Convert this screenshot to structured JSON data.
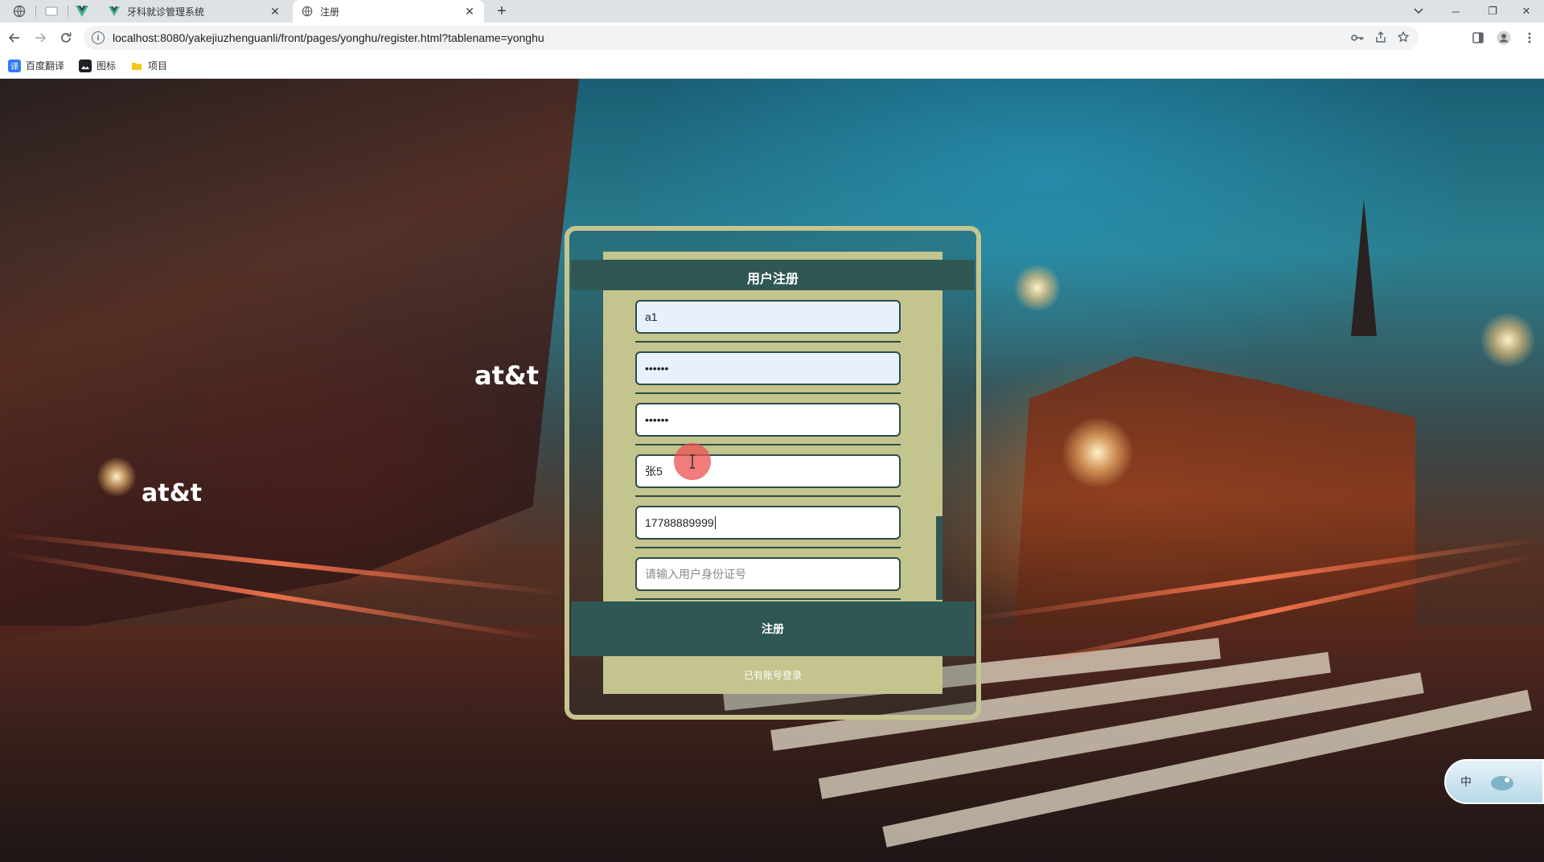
{
  "browser": {
    "tabs": [
      {
        "title": "牙科就诊管理系统",
        "active": false,
        "icon": "vue-logo-icon"
      },
      {
        "title": "注册",
        "active": true,
        "icon": "globe-icon"
      }
    ],
    "url": "localhost:8080/yakejiuzhenguanli/front/pages/yonghu/register.html?tablename=yonghu",
    "bookmarks": [
      {
        "label": "百度翻译",
        "icon": "baidu-translate-icon"
      },
      {
        "label": "图标",
        "icon": "image-icon"
      },
      {
        "label": "项目",
        "icon": "folder-icon"
      }
    ],
    "window_controls": {
      "minimize": "─",
      "restore": "❐",
      "close": "✕"
    }
  },
  "background": {
    "signs": [
      "at&t",
      "at&t"
    ]
  },
  "form": {
    "title": "用户注册",
    "fields": [
      {
        "name": "account",
        "value": "a1",
        "placeholder": "",
        "autofill": true
      },
      {
        "name": "password",
        "value": "••••••",
        "placeholder": "",
        "autofill": true
      },
      {
        "name": "confirm-password",
        "value": "••••••",
        "placeholder": "",
        "autofill": false
      },
      {
        "name": "real-name",
        "value": "张5",
        "placeholder": "",
        "autofill": false
      },
      {
        "name": "phone",
        "value": "17788889999",
        "placeholder": "",
        "autofill": false
      },
      {
        "name": "id-card",
        "value": "",
        "placeholder": "请输入用户身份证号",
        "autofill": false
      }
    ],
    "submit_label": "注册",
    "login_link": "已有账号登录"
  },
  "ime": {
    "label": "中"
  },
  "colors": {
    "panel": "#c4c48e",
    "accent": "#2f5855",
    "frame": "#c6c590"
  }
}
